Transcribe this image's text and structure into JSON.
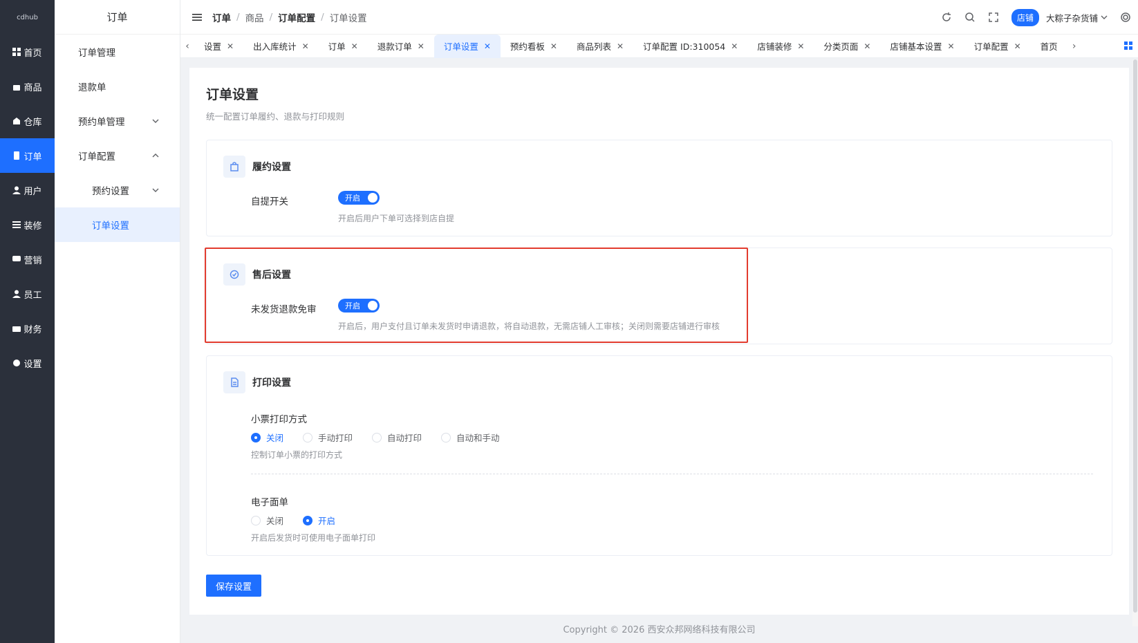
{
  "rail": {
    "logo": "cdhub",
    "items": [
      {
        "label": "首页"
      },
      {
        "label": "商品"
      },
      {
        "label": "仓库"
      },
      {
        "label": "订单"
      },
      {
        "label": "用户"
      },
      {
        "label": "装修"
      },
      {
        "label": "营销"
      },
      {
        "label": "员工"
      },
      {
        "label": "财务"
      },
      {
        "label": "设置"
      }
    ]
  },
  "submenu": {
    "title": "订单",
    "items": [
      {
        "label": "订单管理"
      },
      {
        "label": "退款单"
      },
      {
        "label": "预约单管理"
      },
      {
        "label": "订单配置"
      },
      {
        "label": "预约设置"
      },
      {
        "label": "订单设置"
      }
    ]
  },
  "breadcrumb": {
    "items": [
      "订单",
      "商品",
      "订单配置",
      "订单设置"
    ]
  },
  "header": {
    "shop_badge": "店铺",
    "shop_name": "大粽子杂货铺"
  },
  "tabs": [
    "设置",
    "出入库统计",
    "订单",
    "退款订单",
    "订单设置",
    "预约看板",
    "商品列表",
    "订单配置 ID:310054",
    "店铺装修",
    "分类页面",
    "店铺基本设置",
    "订单配置",
    "首页"
  ],
  "page": {
    "title": "订单设置",
    "subtitle": "统一配置订单履约、退款与打印规则"
  },
  "fulfillment": {
    "title": "履约设置",
    "label": "自提开关",
    "switch_text": "开启",
    "hint": "开启后用户下单可选择到店自提"
  },
  "aftersale": {
    "title": "售后设置",
    "label": "未发货退款免审",
    "switch_text": "开启",
    "hint": "开启后，用户支付且订单未发货时申请退款，将自动退款，无需店铺人工审核；关闭则需要店铺进行审核"
  },
  "print": {
    "title": "打印设置",
    "receipt_label": "小票打印方式",
    "receipt_options": [
      "关闭",
      "手动打印",
      "自动打印",
      "自动和手动"
    ],
    "receipt_hint": "控制订单小票的打印方式",
    "waybill_label": "电子面单",
    "waybill_options": [
      "关闭",
      "开启"
    ],
    "waybill_hint": "开启后发货时可使用电子面单打印"
  },
  "save_label": "保存设置",
  "footer": "Copyright © 2026 西安众邦网络科技有限公司"
}
